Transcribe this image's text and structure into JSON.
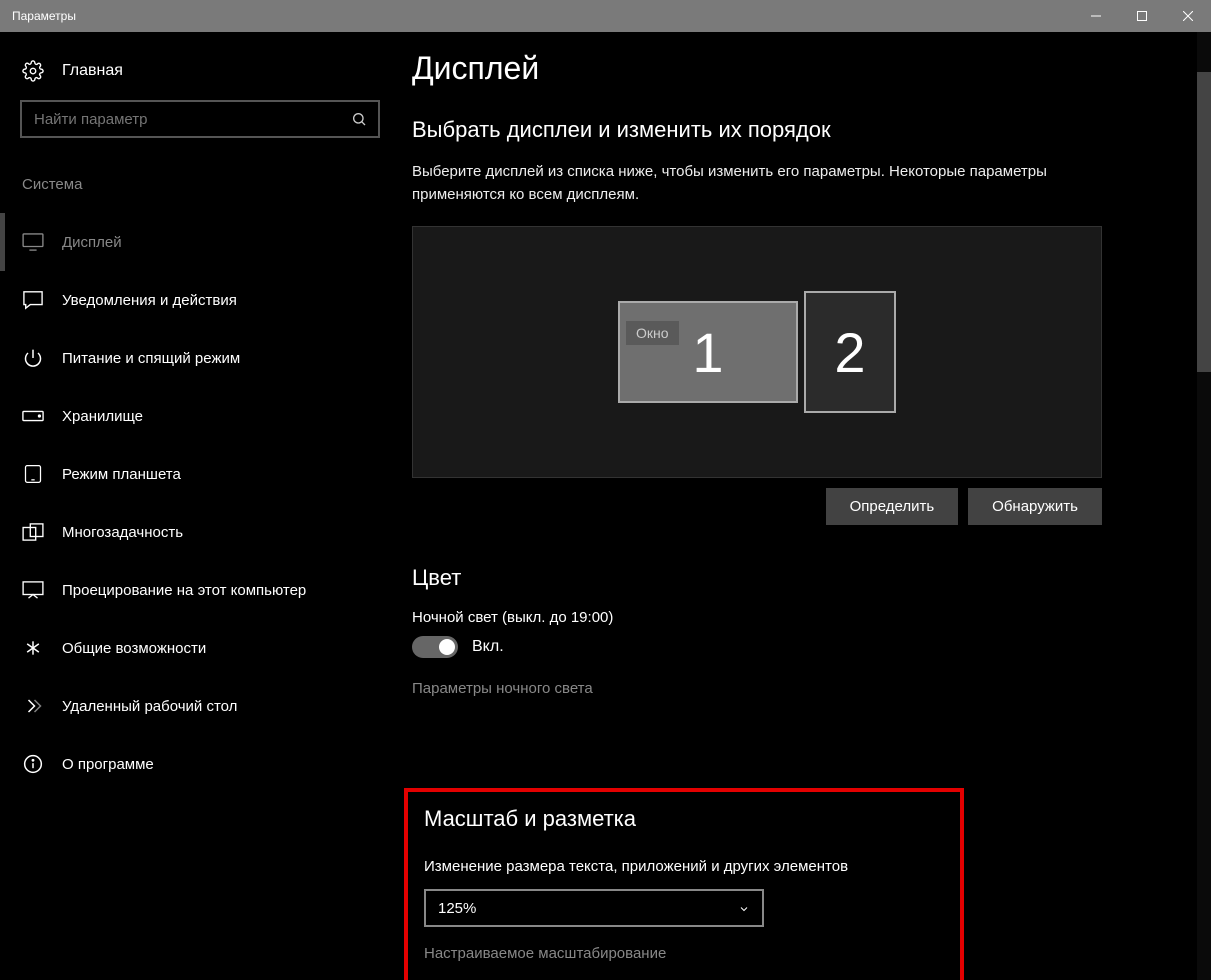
{
  "window": {
    "title": "Параметры"
  },
  "sidebar": {
    "home": "Главная",
    "search_placeholder": "Найти параметр",
    "category": "Система",
    "items": [
      {
        "label": "Дисплей"
      },
      {
        "label": "Уведомления и действия"
      },
      {
        "label": "Питание и спящий режим"
      },
      {
        "label": "Хранилище"
      },
      {
        "label": "Режим планшета"
      },
      {
        "label": "Многозадачность"
      },
      {
        "label": "Проецирование на этот компьютер"
      },
      {
        "label": "Общие возможности"
      },
      {
        "label": "Удаленный рабочий стол"
      },
      {
        "label": "О программе"
      }
    ]
  },
  "main": {
    "title": "Дисплей",
    "arrange_heading": "Выбрать дисплеи и изменить их порядок",
    "arrange_desc": "Выберите дисплей из списка ниже, чтобы изменить его параметры. Некоторые параметры применяются ко всем дисплеям.",
    "window_tag": "Окно",
    "monitor1": "1",
    "monitor2": "2",
    "identify_btn": "Определить",
    "detect_btn": "Обнаружить",
    "color_heading": "Цвет",
    "night_light_status": "Ночной свет (выкл. до 19:00)",
    "toggle_on_label": "Вкл.",
    "night_light_settings": "Параметры ночного света",
    "scale_heading": "Масштаб и разметка",
    "scale_label": "Изменение размера текста, приложений и других элементов",
    "scale_value": "125%",
    "custom_scaling": "Настраиваемое масштабирование"
  }
}
